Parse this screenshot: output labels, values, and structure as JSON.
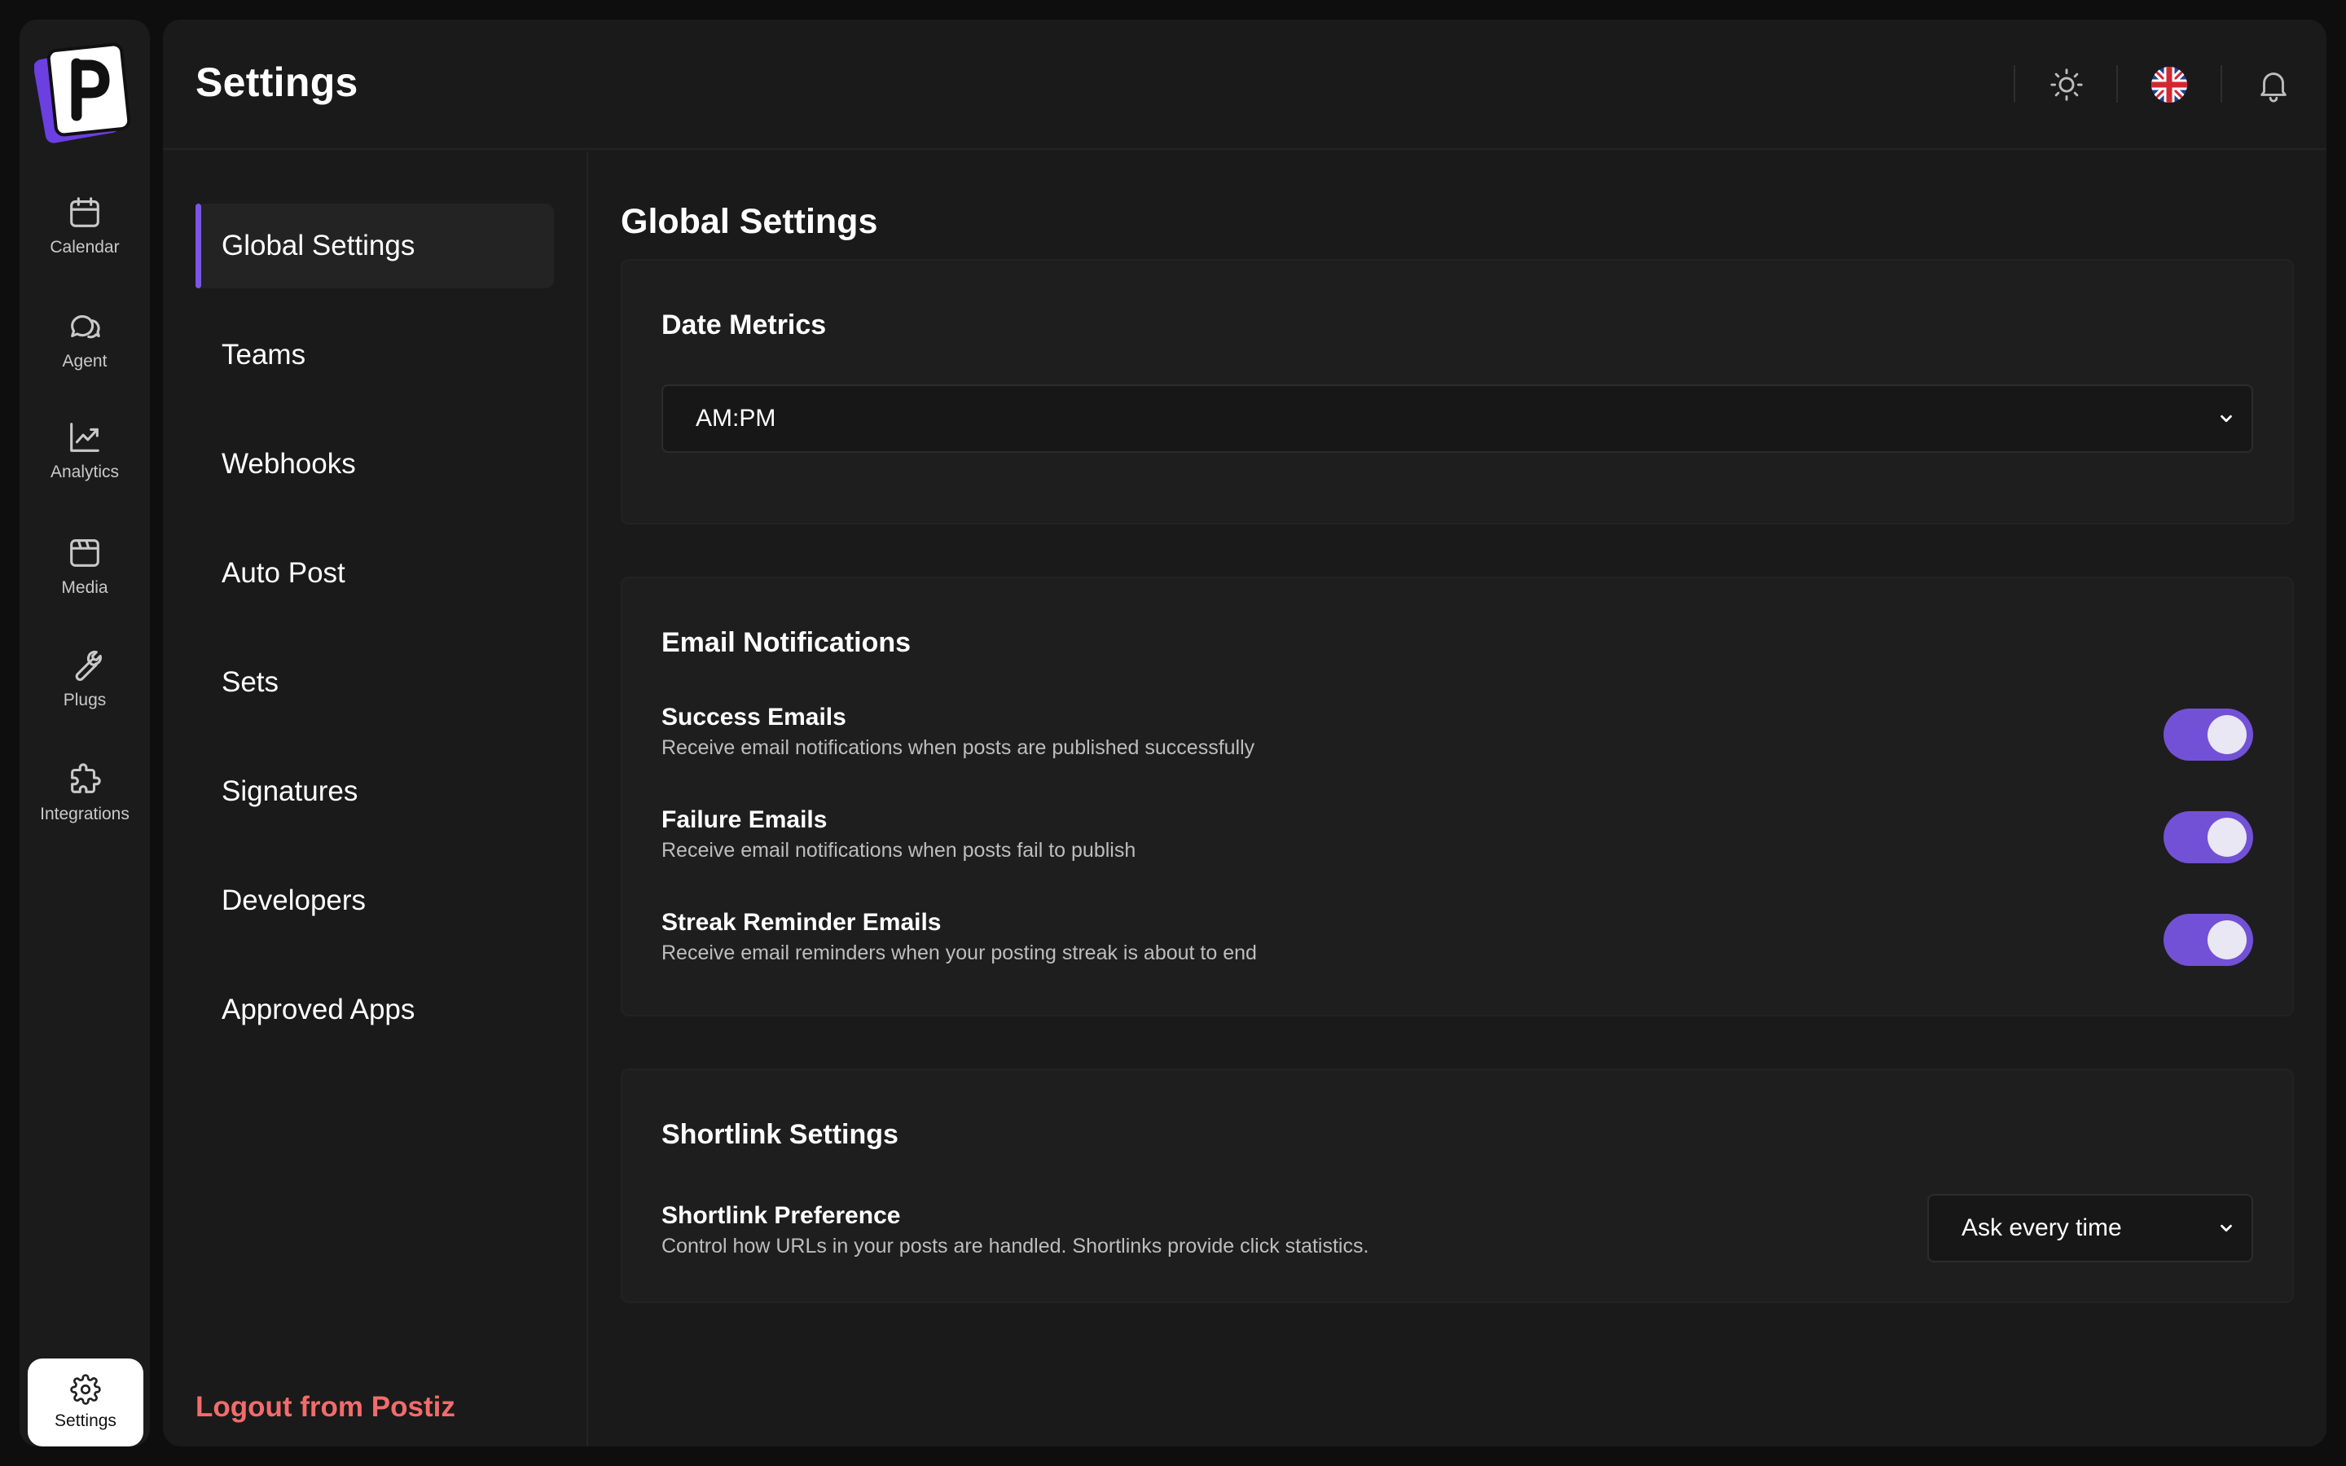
{
  "app": {
    "page_title": "Settings"
  },
  "rail": {
    "items": [
      {
        "label": "Calendar",
        "icon": "calendar-icon"
      },
      {
        "label": "Agent",
        "icon": "chat-icon"
      },
      {
        "label": "Analytics",
        "icon": "chart-icon"
      },
      {
        "label": "Media",
        "icon": "media-icon"
      },
      {
        "label": "Plugs",
        "icon": "wrench-icon"
      },
      {
        "label": "Integrations",
        "icon": "puzzle-icon"
      }
    ],
    "settings": {
      "label": "Settings",
      "icon": "gear-icon"
    }
  },
  "topbar": {
    "icons": [
      "sun-icon",
      "uk-flag-icon",
      "bell-icon"
    ]
  },
  "subnav": {
    "items": [
      {
        "label": "Global Settings",
        "active": true
      },
      {
        "label": "Teams",
        "active": false
      },
      {
        "label": "Webhooks",
        "active": false
      },
      {
        "label": "Auto Post",
        "active": false
      },
      {
        "label": "Sets",
        "active": false
      },
      {
        "label": "Signatures",
        "active": false
      },
      {
        "label": "Developers",
        "active": false
      },
      {
        "label": "Approved Apps",
        "active": false
      }
    ],
    "logout_label": "Logout from Postiz"
  },
  "content": {
    "title": "Global Settings",
    "date_metrics": {
      "title": "Date Metrics",
      "selected": "AM:PM"
    },
    "email_notifications": {
      "title": "Email Notifications",
      "rows": [
        {
          "title": "Success Emails",
          "desc": "Receive email notifications when posts are published successfully",
          "enabled": true
        },
        {
          "title": "Failure Emails",
          "desc": "Receive email notifications when posts fail to publish",
          "enabled": true
        },
        {
          "title": "Streak Reminder Emails",
          "desc": "Receive email reminders when your posting streak is about to end",
          "enabled": true
        }
      ]
    },
    "shortlink": {
      "title": "Shortlink Settings",
      "row_title": "Shortlink Preference",
      "row_desc": "Control how URLs in your posts are handled. Shortlinks provide click statistics.",
      "selected": "Ask every time"
    }
  },
  "colors": {
    "accent": "#7b55e6",
    "toggle_on": "#7251d6",
    "logout": "#f36b6b",
    "logo_purple": "#6b3fe0"
  }
}
